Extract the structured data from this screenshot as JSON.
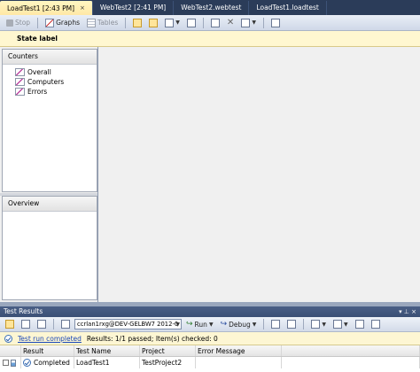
{
  "doc_tabs": [
    {
      "label": "LoadTest1 [2:43 PM]",
      "active": true
    },
    {
      "label": "WebTest2 [2:41 PM]",
      "active": false
    },
    {
      "label": "WebTest2.webtest",
      "active": false
    },
    {
      "label": "LoadTest1.loadtest",
      "active": false
    }
  ],
  "tab_close_glyph": "×",
  "toolbar": {
    "stop_label": "Stop",
    "graphs_label": "Graphs",
    "tables_label": "Tables"
  },
  "state_label": "State label",
  "counters": {
    "header": "Counters",
    "items": [
      "Overall",
      "Computers",
      "Errors"
    ]
  },
  "overview": {
    "header": "Overview"
  },
  "test_results": {
    "title": "Test Results",
    "run_combo": "ccrlan1rxg@DEV-GELBW7 2012-0",
    "run_label": "Run",
    "debug_label": "Debug",
    "status_link": "Test run completed",
    "status_text": "Results: 1/1 passed;  Item(s) checked: 0",
    "columns": [
      "Result",
      "Test Name",
      "Project",
      "Error Message"
    ],
    "rows": [
      {
        "result": "Completed",
        "test_name": "LoadTest1",
        "project": "TestProject2",
        "error": ""
      }
    ]
  }
}
